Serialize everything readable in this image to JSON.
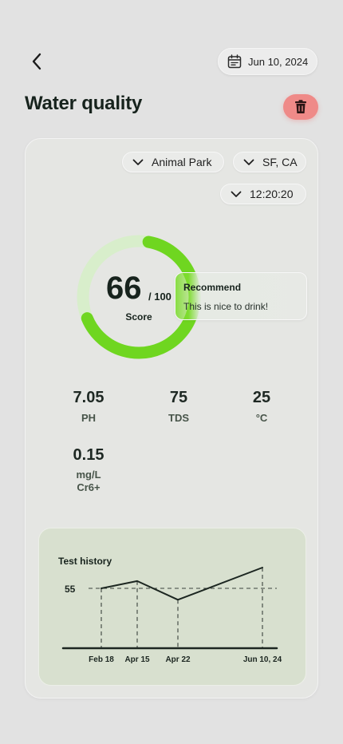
{
  "header": {
    "back_icon": "chevron-left-icon",
    "date_icon": "calendar-icon",
    "date": "Jun 10,  2024",
    "title": "Water quality",
    "delete_icon": "trash-icon",
    "delete_color": "#ef8a88"
  },
  "filters": {
    "location": "Animal Park",
    "city": "SF, CA",
    "time": "12:20:20",
    "chevron_icon": "chevron-down-icon"
  },
  "score": {
    "value": "66",
    "max": "/ 100",
    "label": "Score",
    "fraction": 0.66,
    "color": "#6fd620",
    "track_color": "#d8eecb"
  },
  "recommend": {
    "title": "Recommend",
    "text": "This is nice to drink!"
  },
  "metrics": [
    {
      "value": "7.05",
      "label": "PH"
    },
    {
      "value": "75",
      "label": "TDS"
    },
    {
      "value": "25",
      "label": "°C"
    },
    {
      "value": "0.15",
      "label": "mg/L",
      "sublabel": "Cr6+"
    }
  ],
  "history": {
    "title": "Test history"
  },
  "chart_data": {
    "type": "line",
    "categories": [
      "Feb 18",
      "Apr 15",
      "Apr 22",
      "Jun 10, 24"
    ],
    "values": [
      55,
      62,
      44,
      75
    ],
    "reference_line": {
      "value": 55,
      "label": "55"
    },
    "title": "Test history",
    "xlabel": "",
    "ylabel": ""
  }
}
